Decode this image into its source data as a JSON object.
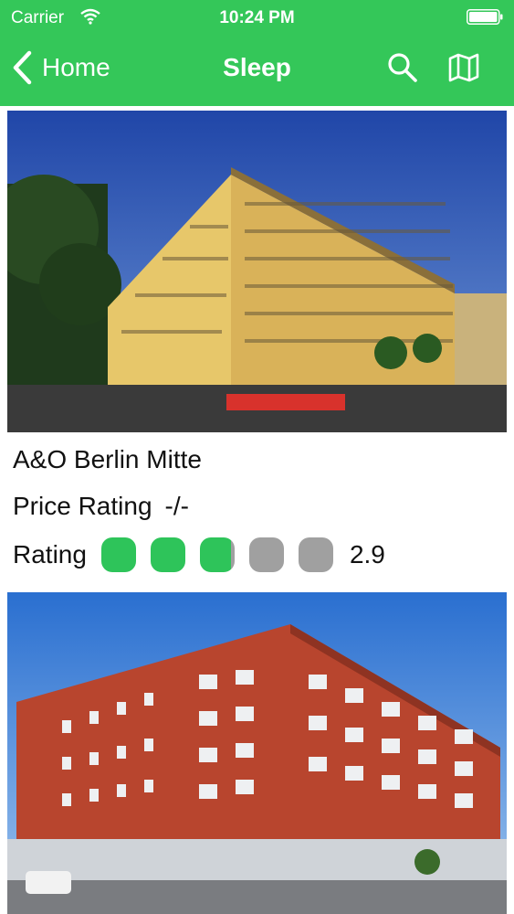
{
  "status_bar": {
    "carrier": "Carrier",
    "time": "10:24 PM"
  },
  "nav": {
    "back_label": "Home",
    "title": "Sleep",
    "icons": [
      "search-icon",
      "map-icon"
    ]
  },
  "hotels": [
    {
      "name": "A&O Berlin Mitte",
      "price_label": "Price Rating",
      "price_value": "-/-",
      "rating_label": "Rating",
      "rating_value": "2.9",
      "rating": 2.9,
      "rating_max": 5
    }
  ],
  "colors": {
    "accent": "#34c759",
    "rating_on": "#2ec45a",
    "rating_off": "#a0a0a0"
  }
}
